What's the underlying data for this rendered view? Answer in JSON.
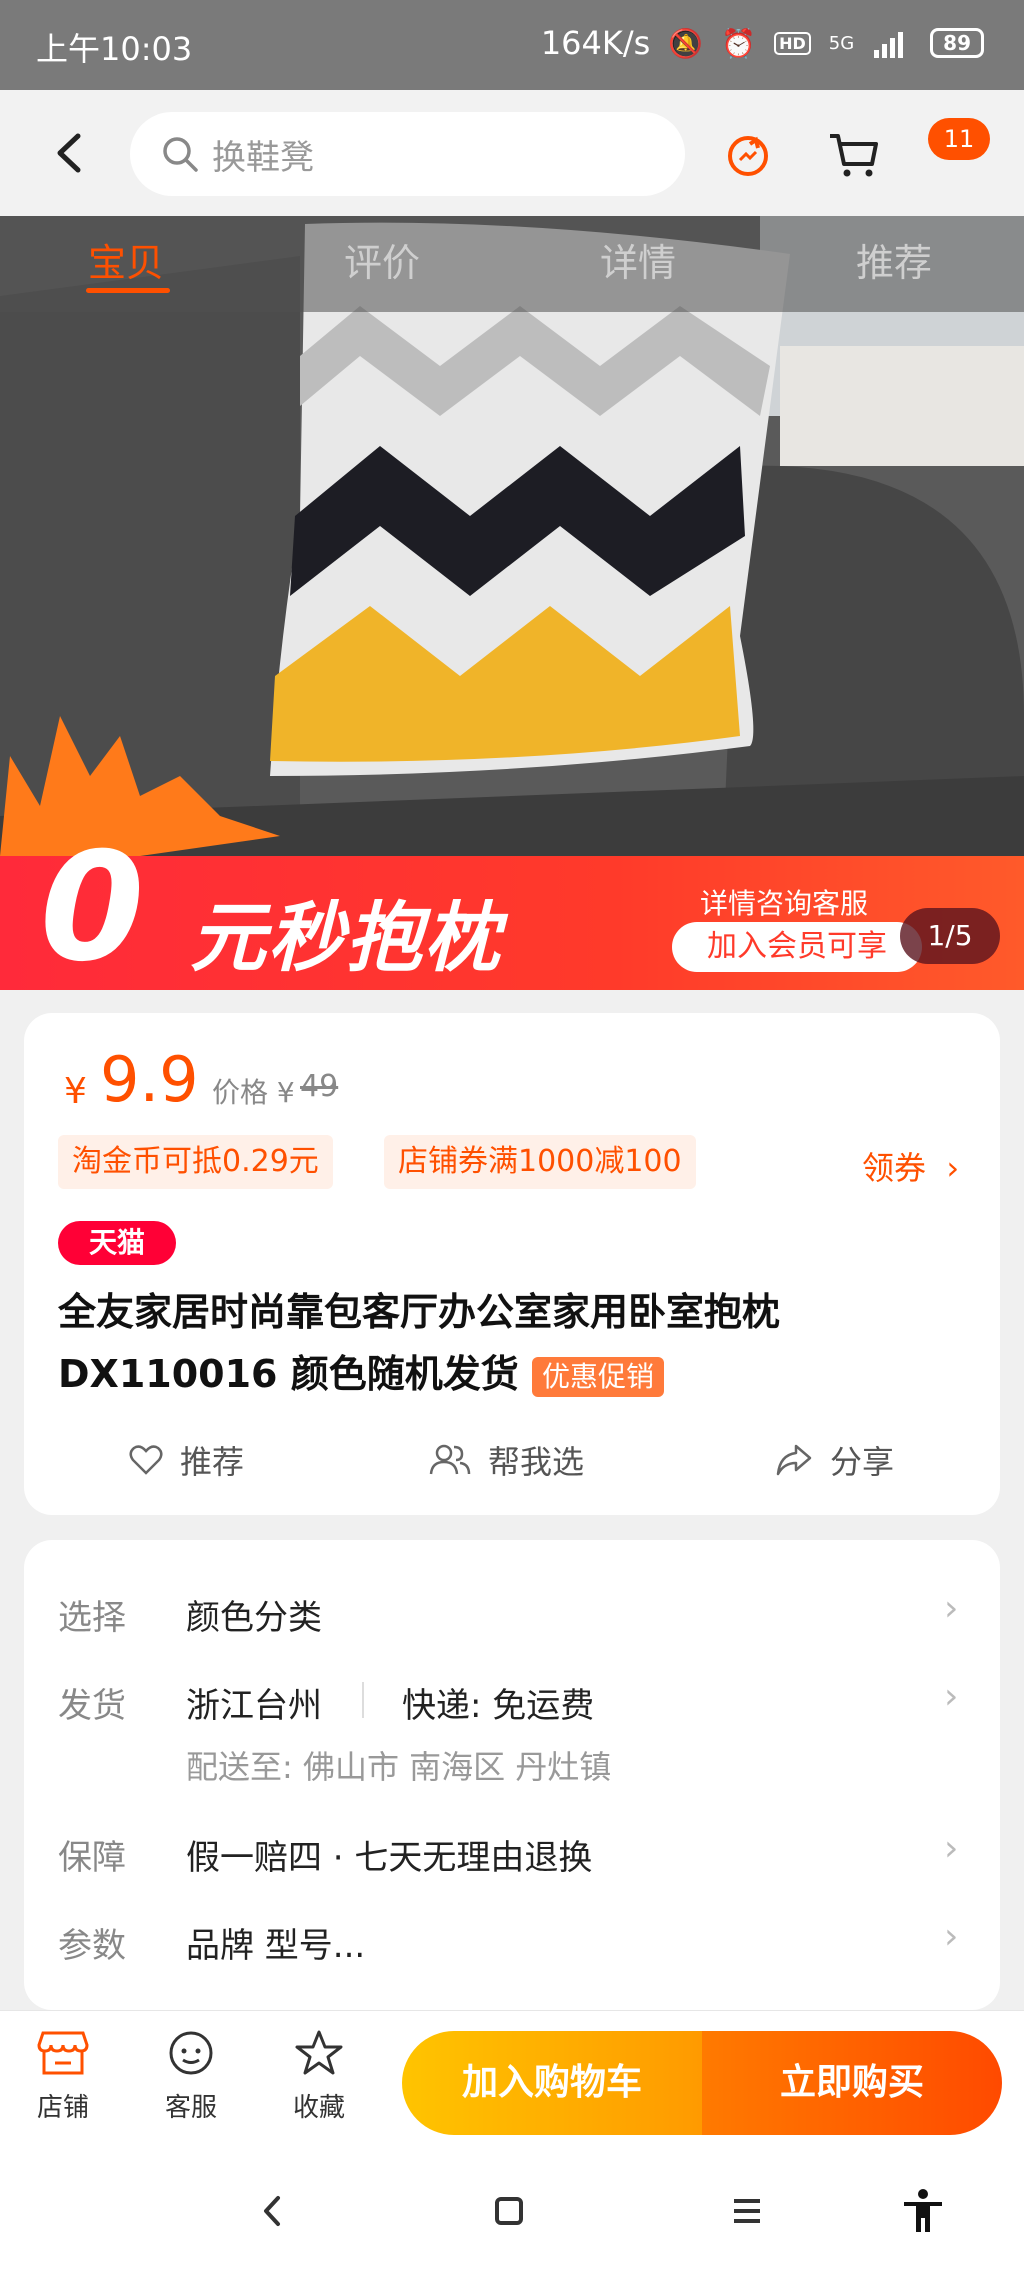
{
  "status_bar": {
    "time": "上午10:03",
    "speed": "164K/s",
    "network": "5G",
    "hd": "HD",
    "battery": "89"
  },
  "top_nav": {
    "search_placeholder": "换鞋凳",
    "cart_badge": "11"
  },
  "tabs": [
    {
      "label": "宝贝",
      "active": true
    },
    {
      "label": "评价",
      "active": false
    },
    {
      "label": "详情",
      "active": false
    },
    {
      "label": "推荐",
      "active": false
    }
  ],
  "banner": {
    "zero": "0",
    "promo_title": "元秒抱枕",
    "promo_sub1": "详情咨询客服",
    "promo_sub2": "加入会员可享",
    "counter": "1/5",
    "colors": {
      "promo_red": "#ff2a3a",
      "pillow_yellow": "#f0b429",
      "pillow_black": "#1d1d24"
    }
  },
  "product": {
    "currency": "¥",
    "price": "9.9",
    "orig_label": "价格 ¥",
    "orig_price": "49",
    "coupons": [
      "淘金币可抵0.29元",
      "店铺券满1000减100"
    ],
    "get_coupon": "领券",
    "platform_tag": "天猫",
    "title": "全友家居时尚靠包客厅办公室家用卧室抱枕DX110016 颜色随机发货",
    "promo_tag": "优惠促销",
    "actions": [
      {
        "icon": "heart-icon",
        "label": "推荐"
      },
      {
        "icon": "people-icon",
        "label": "帮我选"
      },
      {
        "icon": "share-icon",
        "label": "分享"
      }
    ]
  },
  "info": {
    "select": {
      "label": "选择",
      "value": "颜色分类"
    },
    "ship": {
      "label": "发货",
      "origin": "浙江台州",
      "express": "快递: 免运费",
      "deliver_to": "配送至: 佛山市 南海区 丹灶镇"
    },
    "guarantee": {
      "label": "保障",
      "value": "假一赔四 · 七天无理由退换"
    },
    "params": {
      "label": "参数",
      "value": "品牌 型号..."
    }
  },
  "bottom_bar": {
    "shop": "店铺",
    "service": "客服",
    "favorite": "收藏",
    "add_cart": "加入购物车",
    "buy_now": "立即购买"
  },
  "accent_color": "#ff5000"
}
